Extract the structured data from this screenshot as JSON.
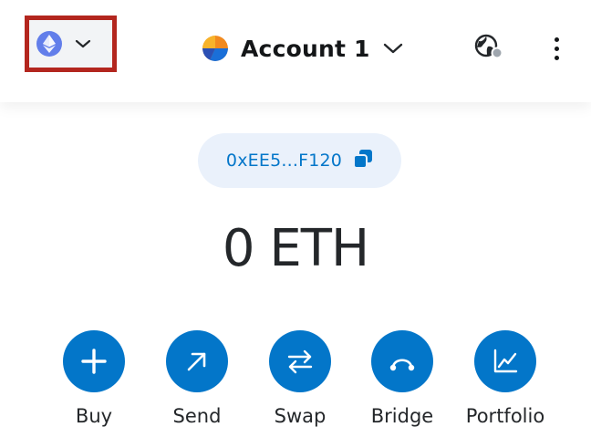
{
  "header": {
    "network": {
      "icon": "ethereum-icon",
      "dropdown_icon": "chevron-down-icon"
    },
    "account": {
      "avatar": "account-avatar",
      "name": "Account 1",
      "dropdown_icon": "chevron-down-icon"
    },
    "site_connection_icon": "globe-icon",
    "menu_icon": "kebab-menu-icon"
  },
  "address": {
    "short": "0xEE5...F120",
    "copy_icon": "copy-icon"
  },
  "balance": {
    "display": "0 ETH"
  },
  "actions": [
    {
      "label": "Buy",
      "icon": "plus-icon"
    },
    {
      "label": "Send",
      "icon": "arrow-up-right-icon"
    },
    {
      "label": "Swap",
      "icon": "swap-arrows-icon"
    },
    {
      "label": "Bridge",
      "icon": "bridge-icon"
    },
    {
      "label": "Portfolio",
      "icon": "chart-icon"
    }
  ],
  "colors": {
    "primary": "#0376c9",
    "highlight_border": "#b3261e",
    "ethereum": "#627eea",
    "address_pill_bg": "#eaf1fb"
  }
}
